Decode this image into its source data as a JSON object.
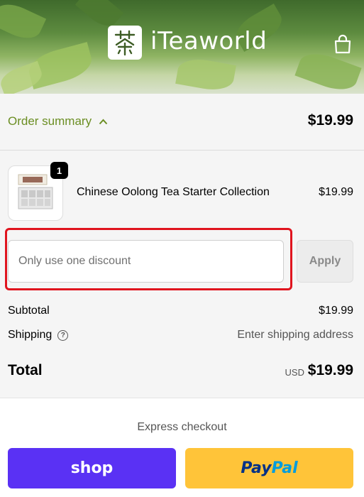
{
  "header": {
    "brand": "iTeaworld",
    "cart_icon": "shopping-bag-icon",
    "logo_icon": "tea-character-logo"
  },
  "summary": {
    "toggle_label": "Order summary",
    "toggle_icon": "chevron-up-icon",
    "total": "$19.99",
    "accent_color": "#6b8e23"
  },
  "product": {
    "quantity": "1",
    "name": "Chinese Oolong Tea Starter Collection",
    "price": "$19.99"
  },
  "discount": {
    "placeholder": "Only use one discount",
    "apply_label": "Apply",
    "highlight_color": "#e0141e"
  },
  "totals": {
    "subtotal_label": "Subtotal",
    "subtotal_value": "$19.99",
    "shipping_label": "Shipping",
    "shipping_value": "Enter shipping address",
    "total_label": "Total",
    "currency": "USD",
    "total_value": "$19.99"
  },
  "express": {
    "title": "Express checkout",
    "shop_label": "shop",
    "paypal_label_a": "Pay",
    "paypal_label_b": "Pal",
    "shop_color": "#5a31f4",
    "paypal_color": "#ffc439"
  }
}
